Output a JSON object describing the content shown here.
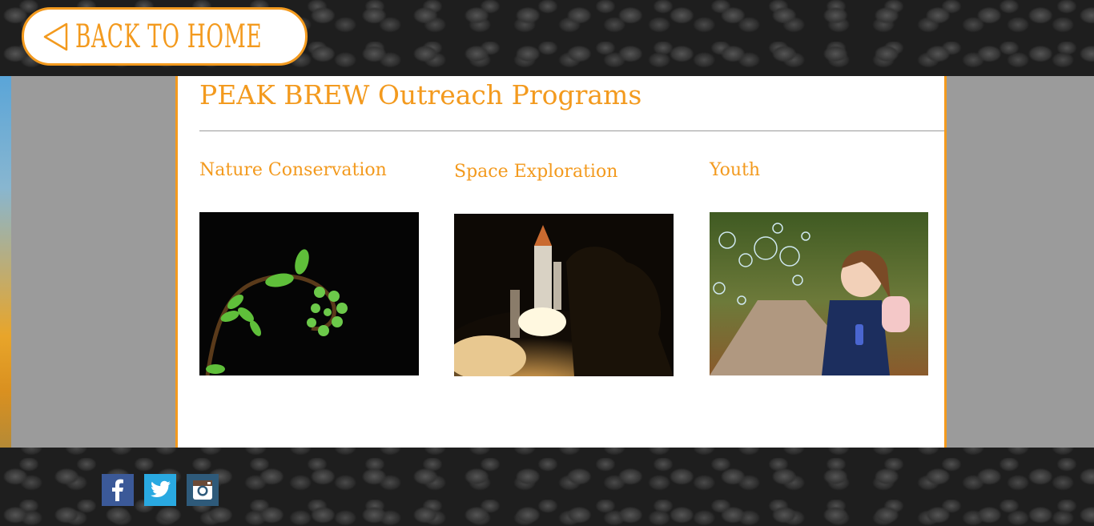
{
  "back_button": {
    "label": "BACK TO HOME",
    "icon": "triangle-left-icon"
  },
  "page": {
    "title": "PEAK BREW Outreach Programs"
  },
  "programs": [
    {
      "title": "Nature Conservation",
      "image": "fern-frond-photo"
    },
    {
      "title": "Space Exploration",
      "image": "rocket-launch-photo"
    },
    {
      "title": "Youth",
      "image": "child-blowing-bubbles-photo"
    }
  ],
  "social": [
    {
      "name": "facebook-icon",
      "glyph": "f"
    },
    {
      "name": "twitter-icon",
      "glyph": "bird"
    },
    {
      "name": "instagram-icon",
      "glyph": "camera"
    }
  ],
  "colors": {
    "accent": "#f39a1e",
    "band": "#9b9b9b",
    "panel": "#ffffff"
  }
}
